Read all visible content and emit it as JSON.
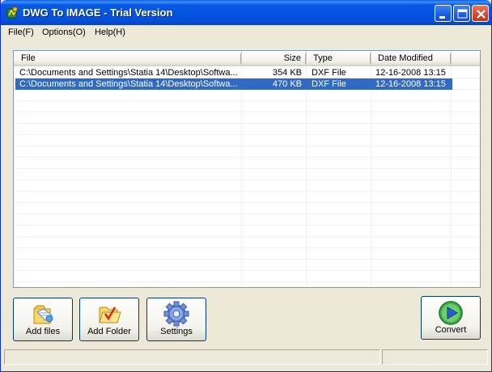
{
  "window": {
    "title": "DWG To IMAGE - Trial Version",
    "title_color": "#ffffff",
    "titlebar_color": "#0454df"
  },
  "menu": {
    "items": [
      {
        "label": "File(F)"
      },
      {
        "label": "Options(O)"
      },
      {
        "label": "Help(H)"
      }
    ]
  },
  "list": {
    "columns": [
      {
        "label": "File"
      },
      {
        "label": "Size"
      },
      {
        "label": "Type"
      },
      {
        "label": "Date Modified"
      }
    ],
    "rows": [
      {
        "file": "C:\\Documents and Settings\\Statia 14\\Desktop\\Softwa...",
        "size": "354 KB",
        "type": "DXF File",
        "date": "12-16-2008 13:15",
        "selected": false
      },
      {
        "file": "C:\\Documents and Settings\\Statia 14\\Desktop\\Softwa...",
        "size": "470 KB",
        "type": "DXF File",
        "date": "12-16-2008 13:15",
        "selected": true
      }
    ],
    "selection_color": "#316ac5"
  },
  "buttons": {
    "add_files": {
      "label": "Add files",
      "icon": "add-file-icon"
    },
    "add_folder": {
      "label": "Add Folder",
      "icon": "add-folder-icon"
    },
    "settings": {
      "label": "Settings",
      "icon": "gear-icon"
    },
    "convert": {
      "label": "Convert",
      "icon": "play-icon"
    }
  },
  "statusbar": {
    "pane1": "",
    "pane2": ""
  }
}
